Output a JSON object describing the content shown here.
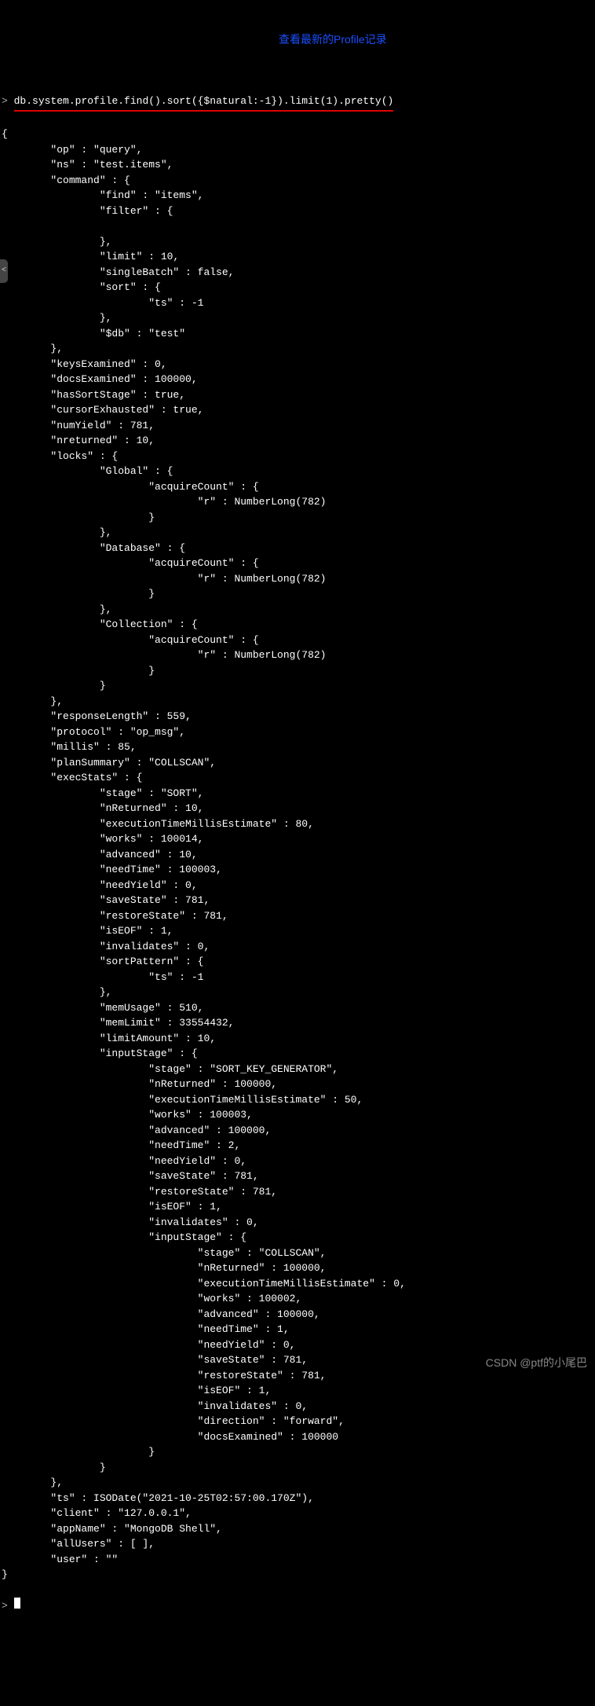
{
  "prompt": ">",
  "command": "db.system.profile.find().sort({$natural:-1}).limit(1).pretty()",
  "annotation": "查看最新的Profile记录",
  "watermark": "CSDN @ptf的小尾巴",
  "output_lines": [
    "{",
    "        \"op\" : \"query\",",
    "        \"ns\" : \"test.items\",",
    "        \"command\" : {",
    "                \"find\" : \"items\",",
    "                \"filter\" : {",
    "",
    "                },",
    "                \"limit\" : 10,",
    "                \"singleBatch\" : false,",
    "                \"sort\" : {",
    "                        \"ts\" : -1",
    "                },",
    "                \"$db\" : \"test\"",
    "        },",
    "        \"keysExamined\" : 0,",
    "        \"docsExamined\" : 100000,",
    "        \"hasSortStage\" : true,",
    "        \"cursorExhausted\" : true,",
    "        \"numYield\" : 781,",
    "        \"nreturned\" : 10,",
    "        \"locks\" : {",
    "                \"Global\" : {",
    "                        \"acquireCount\" : {",
    "                                \"r\" : NumberLong(782)",
    "                        }",
    "                },",
    "                \"Database\" : {",
    "                        \"acquireCount\" : {",
    "                                \"r\" : NumberLong(782)",
    "                        }",
    "                },",
    "                \"Collection\" : {",
    "                        \"acquireCount\" : {",
    "                                \"r\" : NumberLong(782)",
    "                        }",
    "                }",
    "        },",
    "        \"responseLength\" : 559,",
    "        \"protocol\" : \"op_msg\",",
    "        \"millis\" : 85,",
    "        \"planSummary\" : \"COLLSCAN\",",
    "        \"execStats\" : {",
    "                \"stage\" : \"SORT\",",
    "                \"nReturned\" : 10,",
    "                \"executionTimeMillisEstimate\" : 80,",
    "                \"works\" : 100014,",
    "                \"advanced\" : 10,",
    "                \"needTime\" : 100003,",
    "                \"needYield\" : 0,",
    "                \"saveState\" : 781,",
    "                \"restoreState\" : 781,",
    "                \"isEOF\" : 1,",
    "                \"invalidates\" : 0,",
    "                \"sortPattern\" : {",
    "                        \"ts\" : -1",
    "                },",
    "                \"memUsage\" : 510,",
    "                \"memLimit\" : 33554432,",
    "                \"limitAmount\" : 10,",
    "                \"inputStage\" : {",
    "                        \"stage\" : \"SORT_KEY_GENERATOR\",",
    "                        \"nReturned\" : 100000,",
    "                        \"executionTimeMillisEstimate\" : 50,",
    "                        \"works\" : 100003,",
    "                        \"advanced\" : 100000,",
    "                        \"needTime\" : 2,",
    "                        \"needYield\" : 0,",
    "                        \"saveState\" : 781,",
    "                        \"restoreState\" : 781,",
    "                        \"isEOF\" : 1,",
    "                        \"invalidates\" : 0,",
    "                        \"inputStage\" : {",
    "                                \"stage\" : \"COLLSCAN\",",
    "                                \"nReturned\" : 100000,",
    "                                \"executionTimeMillisEstimate\" : 0,",
    "                                \"works\" : 100002,",
    "                                \"advanced\" : 100000,",
    "                                \"needTime\" : 1,",
    "                                \"needYield\" : 0,",
    "                                \"saveState\" : 781,",
    "                                \"restoreState\" : 781,",
    "                                \"isEOF\" : 1,",
    "                                \"invalidates\" : 0,",
    "                                \"direction\" : \"forward\",",
    "                                \"docsExamined\" : 100000",
    "                        }",
    "                }",
    "        },",
    "        \"ts\" : ISODate(\"2021-10-25T02:57:00.170Z\"),",
    "        \"client\" : \"127.0.0.1\",",
    "        \"appName\" : \"MongoDB Shell\",",
    "        \"allUsers\" : [ ],",
    "        \"user\" : \"\"",
    "}"
  ],
  "new_prompt": ">"
}
